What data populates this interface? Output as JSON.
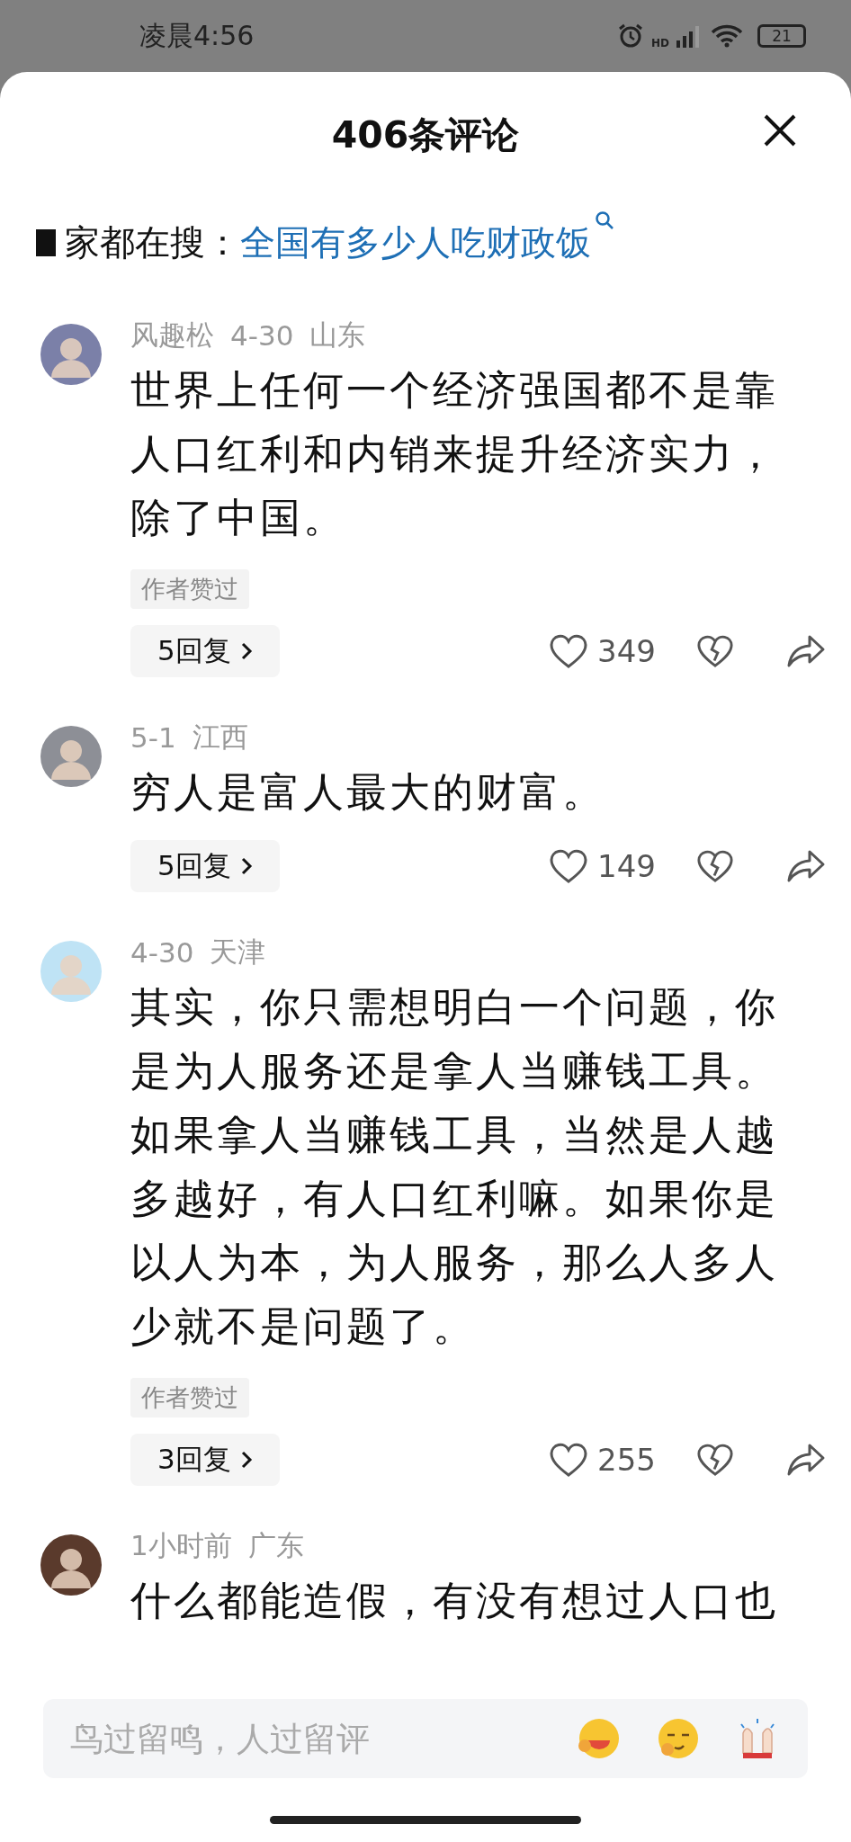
{
  "status_bar": {
    "time": "凌晨4:56",
    "network": "HD",
    "battery": "21"
  },
  "sheet": {
    "title": "406条评论"
  },
  "trending": {
    "prefix": "家都在搜：",
    "query": "全国有多少人吃财政饭"
  },
  "comments": [
    {
      "name": "风趣松",
      "meta": [
        "4-30",
        "山东"
      ],
      "text": "世界上任何一个经济强国都不是靠人口红利和内销来提升经济实力，除了中国。",
      "tag": "作者赞过",
      "replies": "5回复",
      "likes": "349"
    },
    {
      "meta": [
        "5-1",
        "江西"
      ],
      "text": "穷人是富人最大的财富。",
      "replies": "5回复",
      "likes": "149"
    },
    {
      "meta": [
        "4-30",
        "天津"
      ],
      "text": "其实，你只需想明白一个问题，你是为人服务还是拿人当赚钱工具。如果拿人当赚钱工具，当然是人越多越好，有人口红利嘛。如果你是以人为本，为人服务，那么人多人少就不是问题了。",
      "tag": "作者赞过",
      "replies": "3回复",
      "likes": "255"
    },
    {
      "meta": [
        "1小时前",
        "广东"
      ],
      "text": "什么都能造假，有没有想过人口也"
    }
  ],
  "input": {
    "placeholder": "鸟过留鸣，人过留评"
  }
}
